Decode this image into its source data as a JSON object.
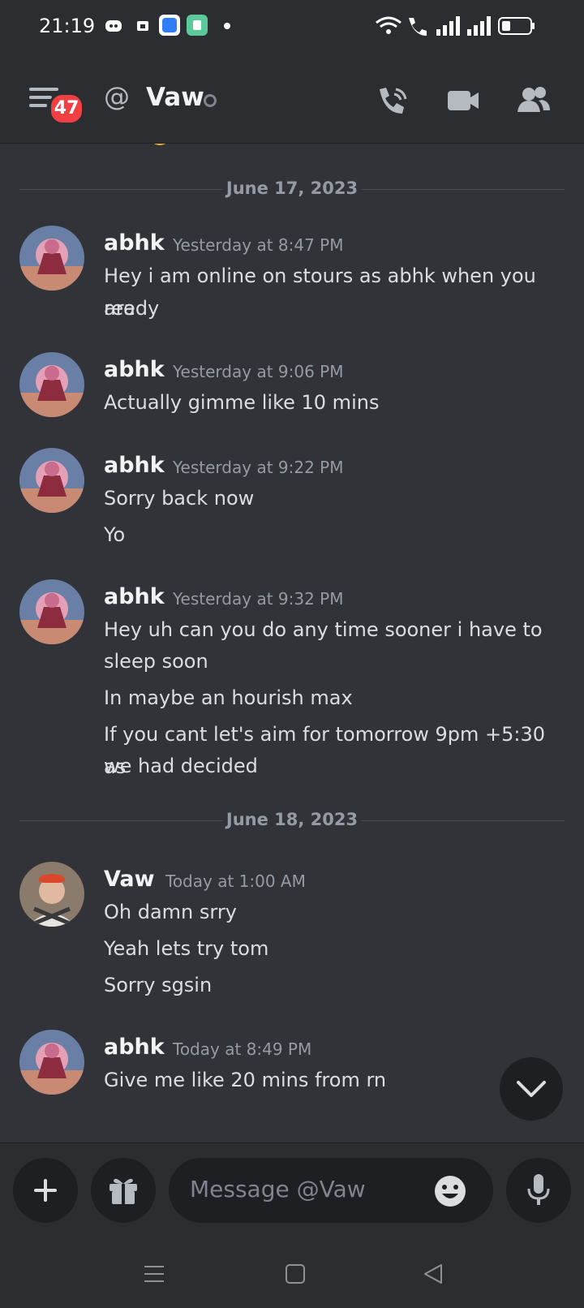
{
  "status": {
    "time": "21:19"
  },
  "header": {
    "badge": "47",
    "at": "@",
    "title": "Vaw"
  },
  "dates": [
    "June 17, 2023",
    "June 18, 2023"
  ],
  "messages": [
    {
      "author": "abhk",
      "time": "Yesterday at 8:47 PM",
      "lines": [
        "Hey i am online on stours as abhk when you are",
        "ready"
      ]
    },
    {
      "author": "abhk",
      "time": "Yesterday at 9:06 PM",
      "lines": [
        "Actually gimme like 10 mins"
      ]
    },
    {
      "author": "abhk",
      "time": "Yesterday at 9:22 PM",
      "lines": [
        "Sorry back now",
        "Yo"
      ]
    },
    {
      "author": "abhk",
      "time": "Yesterday at 9:32 PM",
      "lines": [
        "Hey uh can you do any time sooner i have to",
        "sleep soon",
        "In maybe an hourish max",
        "If you cant let's aim for tomorrow 9pm +5:30 as",
        "we had decided"
      ]
    },
    {
      "author": "Vaw",
      "time": "Today at 1:00 AM",
      "lines": [
        "Oh damn srry",
        "Yeah lets try tom",
        "Sorry sgsin"
      ]
    },
    {
      "author": "abhk",
      "time": "Today at 8:49 PM",
      "lines": [
        "Give me like 20 mins from rn"
      ]
    }
  ],
  "composer": {
    "placeholder": "Message @Vaw"
  },
  "colors": {
    "background": "#313338",
    "header": "#2b2d31",
    "badge": "#f23f43",
    "input": "#1e1f22"
  }
}
